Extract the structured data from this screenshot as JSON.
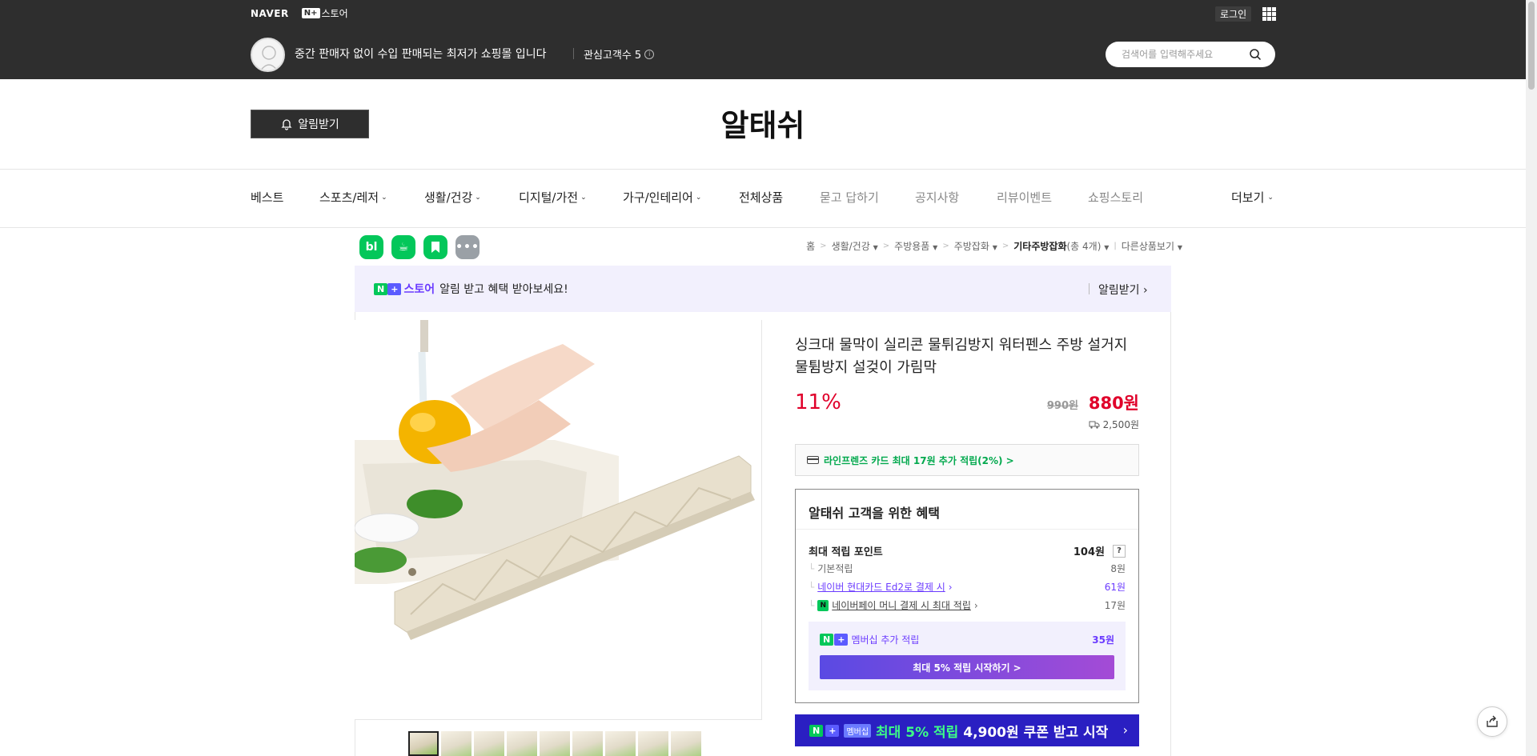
{
  "header": {
    "naver_logo": "NAVER",
    "nplus_badge": "N+",
    "nplus_store": "스토어",
    "login": "로그인",
    "store_description": "중간 판매자 없이 수입 판매되는 최저가 쇼핑몰 입니다",
    "follower_label": "관심고객수 5",
    "follower_info": "i",
    "search_placeholder": "검색어를 입력해주세요"
  },
  "store": {
    "alarm_button": "알림받기",
    "name": "알태쉬"
  },
  "nav": {
    "items": [
      {
        "label": "베스트",
        "dropdown": false,
        "muted": false
      },
      {
        "label": "스포츠/레저",
        "dropdown": true,
        "muted": false
      },
      {
        "label": "생활/건강",
        "dropdown": true,
        "muted": false
      },
      {
        "label": "디지털/가전",
        "dropdown": true,
        "muted": false
      },
      {
        "label": "가구/인테리어",
        "dropdown": true,
        "muted": false
      },
      {
        "label": "전체상품",
        "dropdown": false,
        "muted": false
      },
      {
        "label": "묻고 답하기",
        "dropdown": false,
        "muted": true
      },
      {
        "label": "공지사항",
        "dropdown": false,
        "muted": true
      },
      {
        "label": "리뷰이벤트",
        "dropdown": false,
        "muted": true
      },
      {
        "label": "쇼핑스토리",
        "dropdown": false,
        "muted": true
      }
    ],
    "more": "더보기"
  },
  "app_icons": [
    {
      "name": "blog-icon",
      "glyph": "bl"
    },
    {
      "name": "cafe-icon",
      "glyph": "☕"
    },
    {
      "name": "bookmark-icon",
      "glyph": "▼"
    },
    {
      "name": "more-dots-icon",
      "glyph": "•••"
    }
  ],
  "breadcrumb": {
    "home": "홈",
    "c1": "생활/건강",
    "c2": "주방용품",
    "c3": "주방잡화",
    "current": "기타주방잡화",
    "count": "(총 4개)",
    "other": "다른상품보기"
  },
  "promo": {
    "brand": "스토어",
    "text": "알림 받고 혜택 받아보세요!",
    "link": "알림받기"
  },
  "product": {
    "title": "싱크대 물막이 실리콘 물튀김방지 워터펜스 주방 설거지 물튐방지 설겆이 가림막",
    "discount": "11%",
    "original_price": "990원",
    "sale_price": "880원",
    "shipping": "2,500원",
    "card_offer": "라인프렌즈 카드 최대 17원 추가 적립(2%) >",
    "thumbnail_count": 9
  },
  "benefit": {
    "title": "알태쉬 고객을 위한 혜택",
    "max_point_label": "최대 적립 포인트",
    "max_point_value": "104원",
    "help": "?",
    "basic_label": "기본적립",
    "basic_value": "8원",
    "hyundai_label": "네이버 현대카드 Ed2로 결제 시",
    "hyundai_value": "61원",
    "npay_label": "네이버페이 머니 결제 시 최대 적립",
    "npay_value": "17원",
    "npay_badge": "N",
    "member_label": "멤버십 추가 적립",
    "member_value": "35원",
    "member_button": "최대 5% 적립 시작하기 >"
  },
  "coupon": {
    "badge": "멤버십",
    "highlight": "최대 5% 적립",
    "text": "4,900원 쿠폰 받고 시작",
    "arrow": "›"
  },
  "colors": {
    "header_bg": "#2e2e2e",
    "discount_red": "#e0002a",
    "naver_green": "#03c75a",
    "membership_purple": "#6b3bff",
    "coupon_bg": "#2a1fc2"
  }
}
